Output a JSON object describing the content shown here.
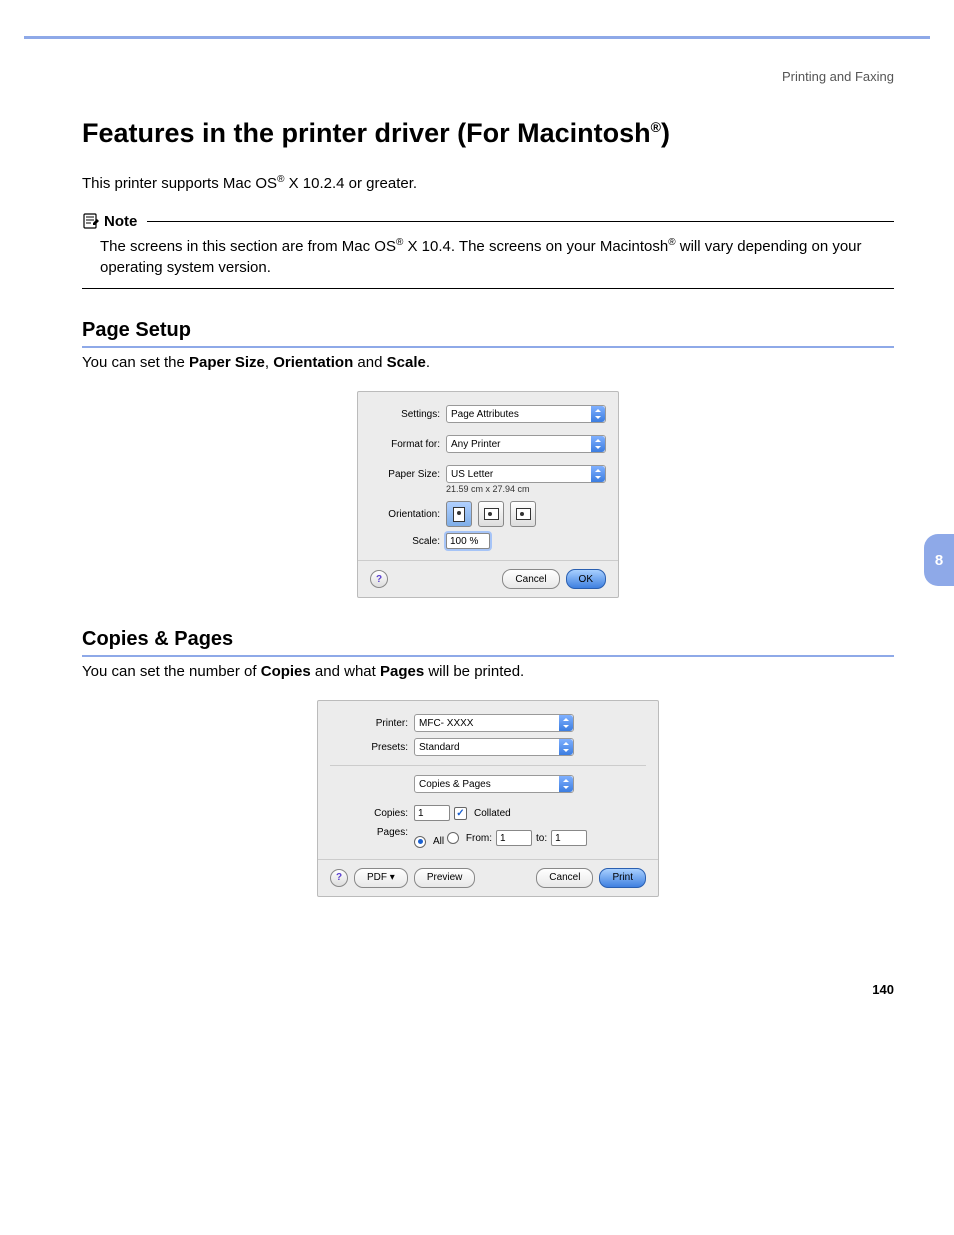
{
  "header": {
    "section": "Printing and Faxing"
  },
  "title": "Features in the printer driver (For Macintosh®)",
  "title_pre": "Features in the printer driver (For Macintosh",
  "title_suf": ")",
  "intro": "This printer supports Mac OS® X 10.2.4 or greater.",
  "intro_pre": "This printer supports Mac OS",
  "intro_suf": " X 10.2.4 or greater.",
  "note": {
    "label": "Note",
    "text_pre": "The screens in this section are from Mac OS",
    "text_mid": " X 10.4. The screens on your Macintosh",
    "text_suf": " will vary depending on your operating system version."
  },
  "section1": {
    "heading": "Page Setup",
    "desc_pre": "You can set the ",
    "b1": "Paper Size",
    "sep1": ", ",
    "b2": "Orientation",
    "sep2": " and ",
    "b3": "Scale",
    "suf": "."
  },
  "dlg1": {
    "settings_lbl": "Settings:",
    "settings_val": "Page Attributes",
    "format_lbl": "Format for:",
    "format_val": "Any Printer",
    "paper_lbl": "Paper Size:",
    "paper_val": "US Letter",
    "paper_dim": "21.59 cm x 27.94 cm",
    "orient_lbl": "Orientation:",
    "scale_lbl": "Scale:",
    "scale_val": "100 %",
    "cancel": "Cancel",
    "ok": "OK"
  },
  "section2": {
    "heading": "Copies & Pages",
    "desc_pre": "You can set the number of ",
    "b1": "Copies",
    "sep1": " and what ",
    "b2": "Pages",
    "suf": " will be printed."
  },
  "dlg2": {
    "printer_lbl": "Printer:",
    "printer_val": "MFC- XXXX",
    "presets_lbl": "Presets:",
    "presets_val": "Standard",
    "section_val": "Copies & Pages",
    "copies_lbl": "Copies:",
    "copies_val": "1",
    "collated_lbl": "Collated",
    "pages_lbl": "Pages:",
    "all_lbl": "All",
    "from_lbl": "From:",
    "from_val": "1",
    "to_lbl": "to:",
    "to_val": "1",
    "pdf": "PDF ▾",
    "preview": "Preview",
    "cancel": "Cancel",
    "print": "Print"
  },
  "chapter": "8",
  "pagenum": "140"
}
